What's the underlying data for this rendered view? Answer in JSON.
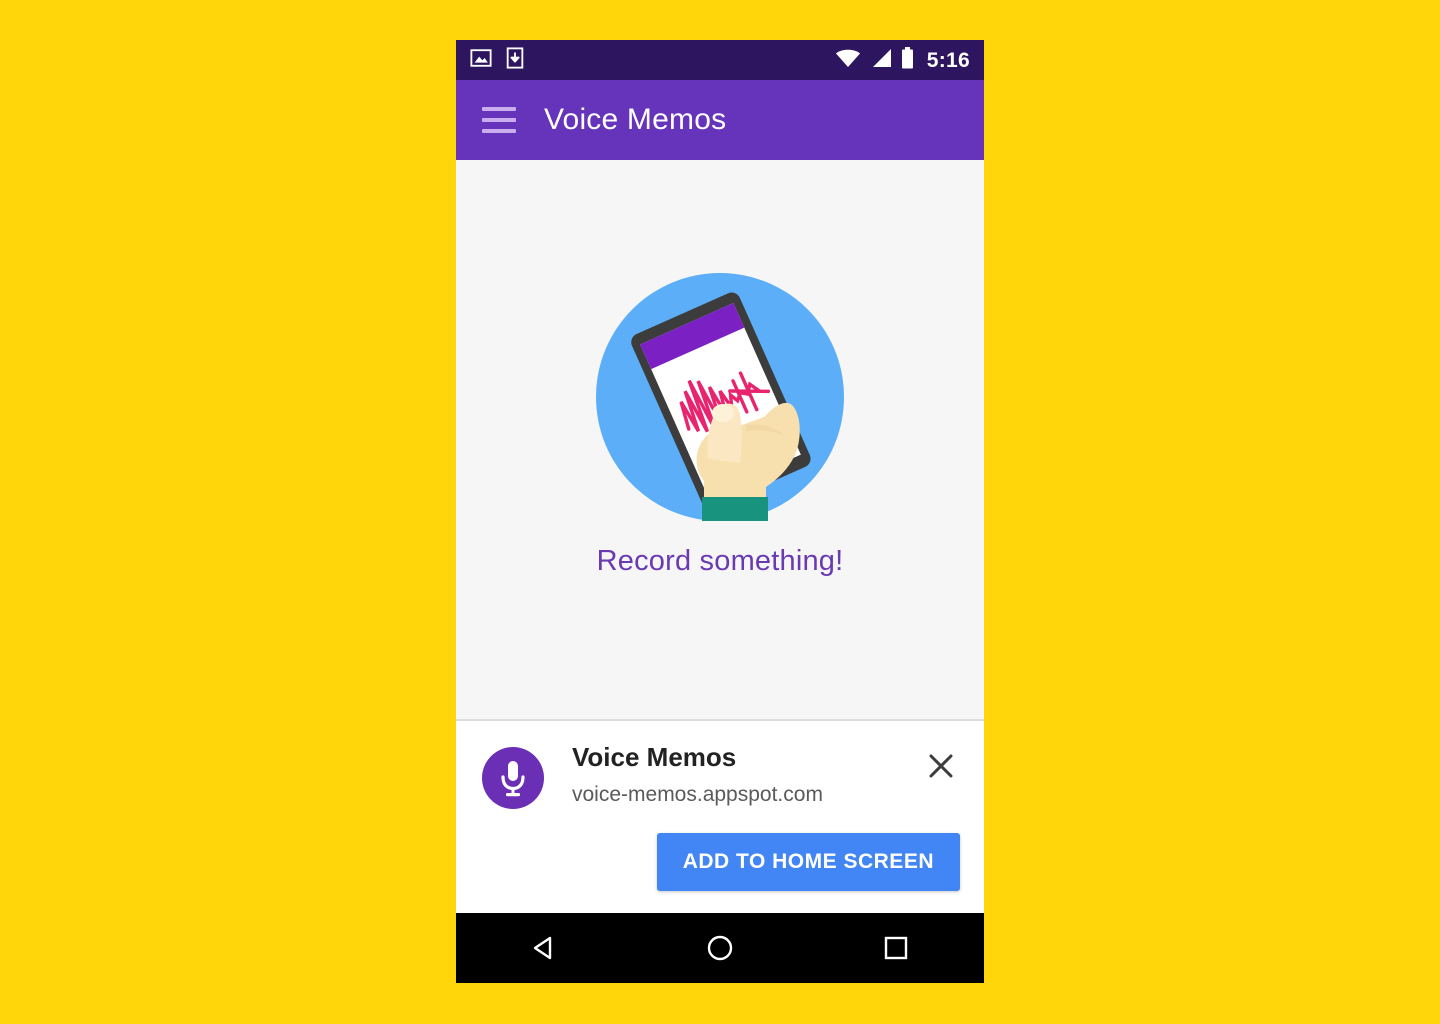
{
  "background": {
    "color": "#FFD60A"
  },
  "phone": {
    "status_bar": {
      "background": "#2D1560",
      "time": "5:16",
      "icons": [
        {
          "name": "image-icon",
          "label": "image"
        },
        {
          "name": "download-icon",
          "label": "download"
        },
        {
          "name": "wifi-icon",
          "label": "wifi"
        },
        {
          "name": "cell-signal-icon",
          "label": "signal"
        },
        {
          "name": "battery-icon",
          "label": "battery"
        }
      ]
    },
    "app_bar": {
      "background": "#6633BB",
      "menu_icon": "hamburger-menu-icon",
      "title": "Voice Memos"
    },
    "content": {
      "background": "#F6F6F6",
      "illustration": {
        "name": "hand-holding-phone-recording-illustration",
        "circle_color": "#5BAEF7",
        "phone_body_color": "#3C3C3C",
        "phone_screen_color": "#FFFFFF",
        "phone_appbar_color": "#7B21C4",
        "waveform_color": "#E8246E",
        "hand_color": "#F7DFAE",
        "sleeve_color": "#17937E"
      },
      "empty_message": "Record something!",
      "empty_message_color": "#6A3AB2"
    },
    "install_banner": {
      "app_icon": {
        "name": "microphone-icon",
        "background": "#6A2FB5",
        "glyph_color": "#FFFFFF"
      },
      "title": "Voice Memos",
      "url": "voice-memos.appspot.com",
      "close_label": "Close",
      "add_button_label": "ADD TO HOME SCREEN",
      "add_button_color": "#4285F4"
    },
    "nav_bar": {
      "background": "#000000",
      "buttons": [
        {
          "name": "nav-back-button",
          "label": "Back"
        },
        {
          "name": "nav-home-button",
          "label": "Home"
        },
        {
          "name": "nav-recents-button",
          "label": "Recents"
        }
      ]
    }
  }
}
